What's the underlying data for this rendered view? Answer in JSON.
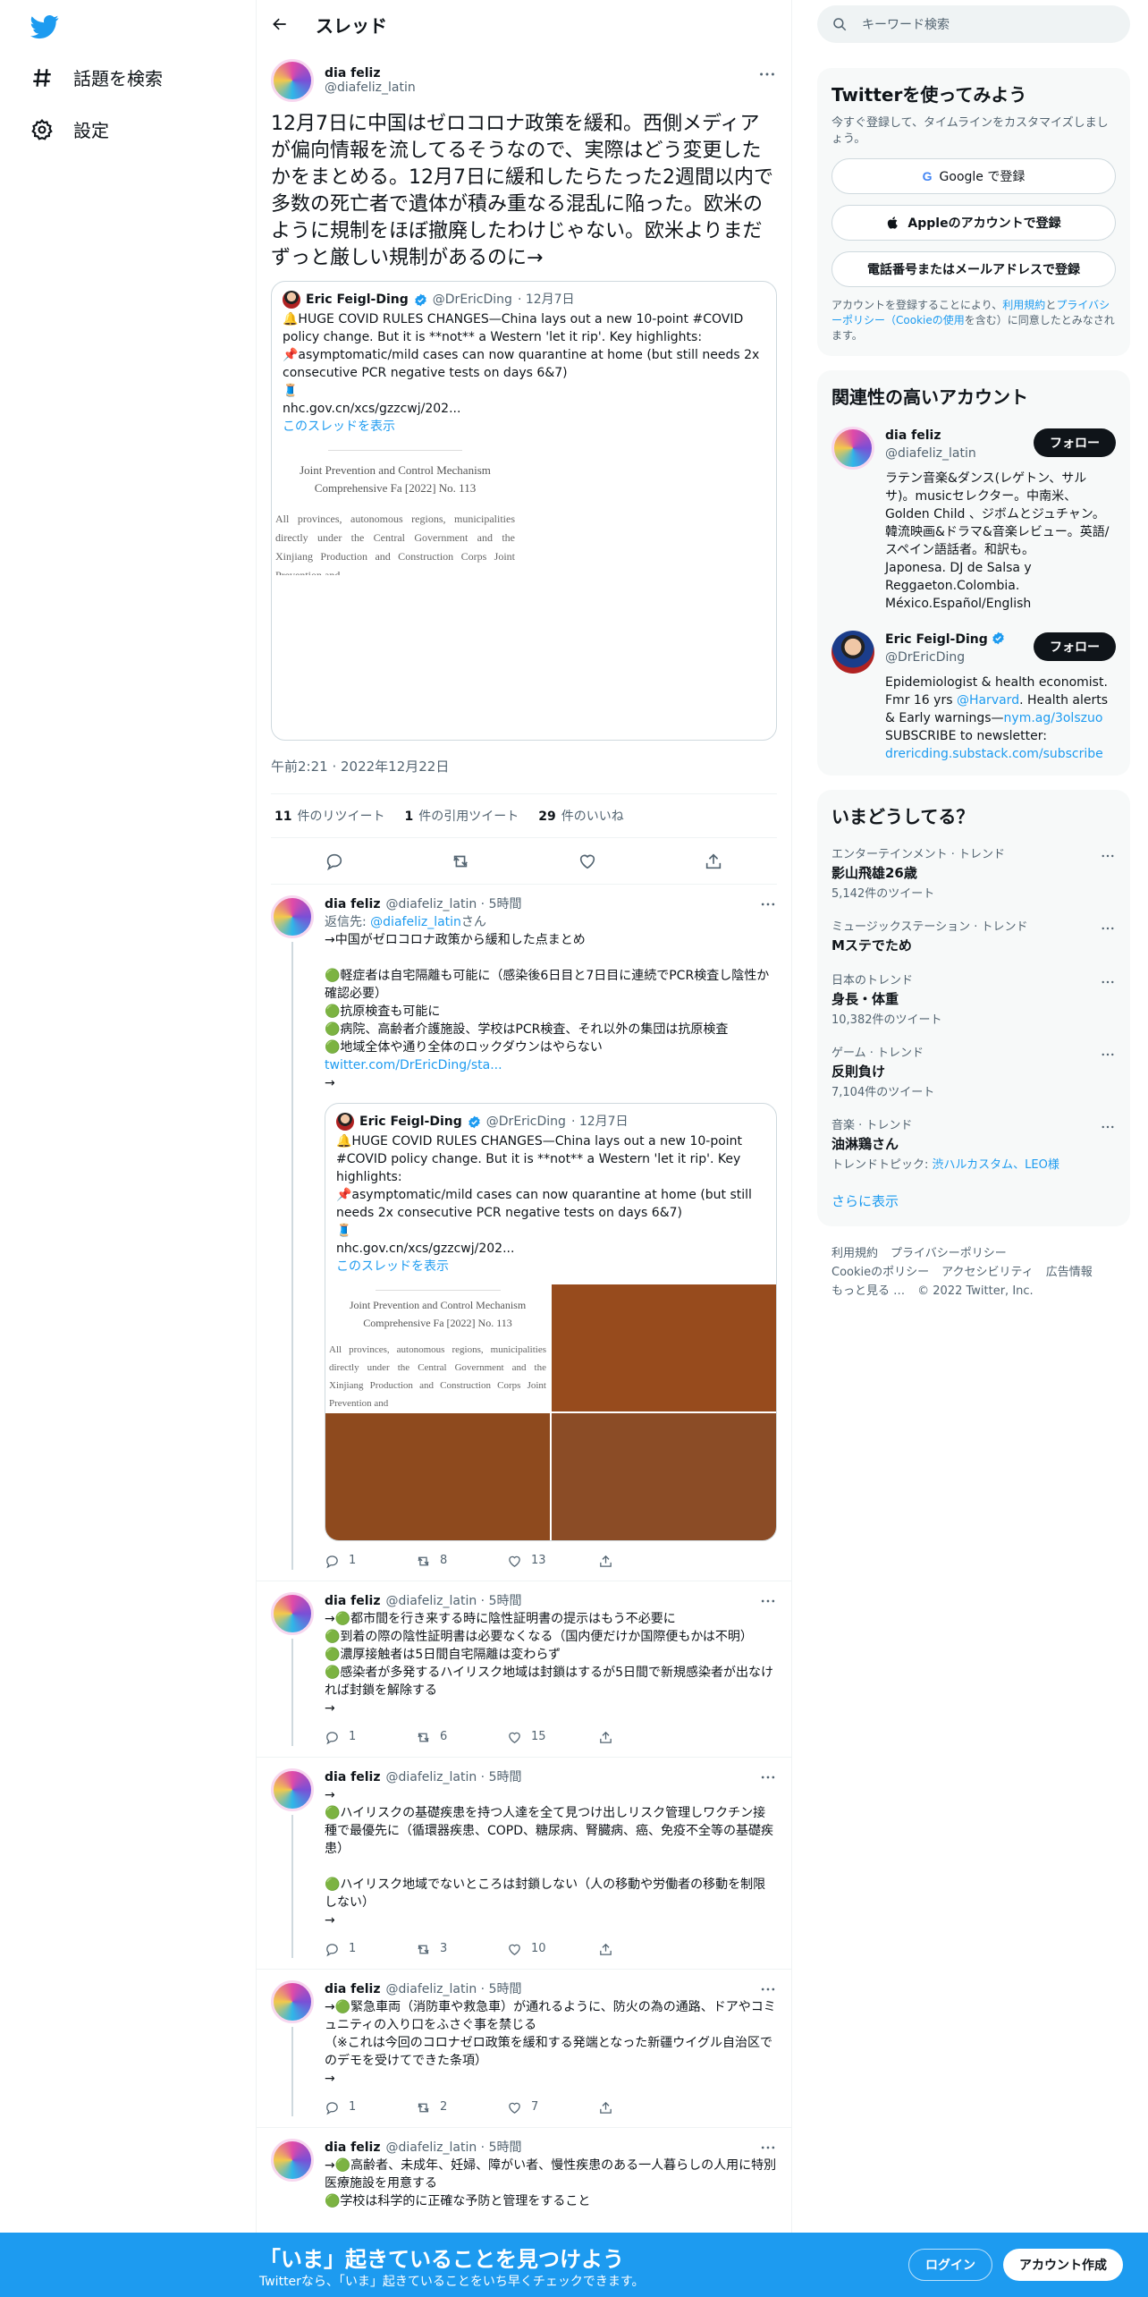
{
  "nav": {
    "explore": "話題を検索",
    "settings": "設定"
  },
  "header": {
    "title": "スレッド"
  },
  "focus": {
    "name": "dia feliz",
    "handle": "@diafeliz_latin",
    "text": "12月7日に中国はゼロコロナ政策を緩和。西側メディアが偏向情報を流してるそうなので、実際はどう変更したかをまとめる。12月7日に緩和したらたった2週間以内で多数の死亡者で遺体が積み重なる混乱に陥った。欧米のように規制をほぼ撤廃したわけじゃない。欧米よりまだずっと厳しい規制があるのに→",
    "quote": {
      "name": "Eric Feigl-Ding",
      "handle": "@DrEricDing",
      "date": "· 12月7日",
      "text": "🔔HUGE COVID RULES CHANGES—China lays out a new 10-point #COVID policy change. But it is **not** a Western 'let it rip'. Key highlights:\n📌asymptomatic/mild cases can now quarantine at home (but still needs 2x consecutive PCR negative tests on days 6&7)\n🧵\nnhc.gov.cn/xcs/gzzcwj/202...",
      "thread_link": "このスレッドを表示",
      "doc_title": "Joint Prevention and Control Mechanism\nComprehensive Fa [2022] No. 113",
      "doc_body": "All provinces, autonomous regions, municipalities directly under the Central Government and the Xinjiang Production and Construction Corps Joint Prevention and"
    },
    "time": "午前2:21 · 2022年12月22日",
    "retweets_num": "11",
    "retweets_label": "件のリツイート",
    "quotes_num": "1",
    "quotes_label": "件の引用ツイート",
    "likes_num": "29",
    "likes_label": "件のいいね"
  },
  "replies": [
    {
      "name": "dia feliz",
      "meta": "@diafeliz_latin · 5時間",
      "reply_to_label": "返信先: ",
      "reply_to_handle": "@diafeliz_latin",
      "reply_to_suffix": "さん",
      "text": "→中国がゼロコロナ政策から緩和した点まとめ\n\n🟢軽症者は自宅隔離も可能に（感染後6日目と7日目に連続でPCR検査し陰性か確認必要）\n🟢抗原検査も可能に\n🟢病院、高齢者介護施設、学校はPCR検査、それ以外の集団は抗原検査\n🟢地域全体や通り全体のロックダウンはやらない",
      "link": "twitter.com/DrEricDing/sta...",
      "tail": "→",
      "quote": {
        "name": "Eric Feigl-Ding",
        "handle": "@DrEricDing",
        "date": "· 12月7日",
        "text": "🔔HUGE COVID RULES CHANGES—China lays out a new 10-point #COVID policy change. But it is **not** a Western 'let it rip'. Key highlights:\n📌asymptomatic/mild cases can now quarantine at home (but still needs 2x consecutive PCR negative tests on days 6&7)\n🧵\nnhc.gov.cn/xcs/gzzcwj/202...",
        "thread_link": "このスレッドを表示"
      },
      "replies": "1",
      "retweets": "8",
      "likes": "13"
    },
    {
      "name": "dia feliz",
      "meta": "@diafeliz_latin · 5時間",
      "text": "→🟢都市間を行き来する時に陰性証明書の提示はもう不必要に\n🟢到着の際の陰性証明書は必要なくなる（国内便だけか国際便もかは不明）\n🟢濃厚接触者は5日間自宅隔離は変わらず\n🟢感染者が多発するハイリスク地域は封鎖はするが5日間で新規感染者が出なければ封鎖を解除する\n→",
      "replies": "1",
      "retweets": "6",
      "likes": "15"
    },
    {
      "name": "dia feliz",
      "meta": "@diafeliz_latin · 5時間",
      "text": "→\n🟢ハイリスクの基礎疾患を持つ人達を全て見つけ出しリスク管理しワクチン接種で最優先に（循環器疾患、COPD、糖尿病、腎臓病、癌、免疫不全等の基礎疾患）\n\n🟢ハイリスク地域でないところは封鎖しない（人の移動や労働者の移動を制限しない）\n→",
      "replies": "1",
      "retweets": "3",
      "likes": "10"
    },
    {
      "name": "dia feliz",
      "meta": "@diafeliz_latin · 5時間",
      "text": "→🟢緊急車両（消防車や救急車）が通れるように、防火の為の通路、ドアやコミュニティの入り口をふさぐ事を禁じる\n（※これは今回のコロナゼロ政策を緩和する発端となった新疆ウイグル自治区でのデモを受けてできた条項）\n→",
      "replies": "1",
      "retweets": "2",
      "likes": "7"
    },
    {
      "name": "dia feliz",
      "meta": "@diafeliz_latin · 5時間",
      "text": "→🟢高齢者、未成年、妊婦、障がい者、慢性疾患のある一人暮らしの人用に特別医療施設を用意する\n🟢学校は科学的に正確な予防と管理をすること"
    }
  ],
  "search": {
    "placeholder": "キーワード検索"
  },
  "signup": {
    "title": "Twitterを使ってみよう",
    "sub": "今すぐ登録して、タイムラインをカスタマイズしましょう。",
    "google": "Google で登録",
    "apple": "Appleのアカウントで登録",
    "phone": "電話番号またはメールアドレスで登録",
    "terms_prefix": "アカウントを登録することにより、",
    "terms_link1": "利用規約",
    "terms_mid": "と",
    "terms_link2": "プライバシーポリシー（Cookieの使用",
    "terms_suffix": "を含む）に同意したとみなされます。"
  },
  "relevant": {
    "title": "関連性の高いアカウント",
    "follow": "フォロー",
    "accounts": [
      {
        "name": "dia feliz",
        "handle": "@diafeliz_latin",
        "bio": "ラテン音楽&ダンス(レゲトン、サルサ)。musicセレクター。中南米、Golden Child 、ジボムとジュチャン。韓流映画&ドラマ&音楽レビュー。英語/スペイン語話者。和訳も。\nJaponesa. DJ de Salsa y Reggaeton.Colombia. México.Español/English"
      },
      {
        "name": "Eric Feigl-Ding",
        "handle": "@DrEricDing",
        "bio_pre": "Epidemiologist & health economist. Fmr 16 yrs ",
        "bio_link1": "@Harvard",
        "bio_mid": ". Health alerts & Early warnings—",
        "bio_link2": "nym.ag/3olszuo",
        "bio_post": " SUBSCRIBE to newsletter: ",
        "bio_link3": "drericding.substack.com/subscribe"
      }
    ]
  },
  "trends": {
    "title": "いまどうしてる？",
    "items": [
      {
        "cat": "エンターテインメント · トレンド",
        "name": "影山飛雄26歳",
        "count": "5,142件のツイート"
      },
      {
        "cat": "ミュージックステーション · トレンド",
        "name": "Mステでため",
        "count": ""
      },
      {
        "cat": "日本のトレンド",
        "name": "身長・体重",
        "count": "10,382件のツイート"
      },
      {
        "cat": "ゲーム · トレンド",
        "name": "反則負け",
        "count": "7,104件のツイート"
      },
      {
        "cat": "音楽 · トレンド",
        "name": "油淋鶏さん",
        "count_prefix": "トレンドトピック: ",
        "count_link": "渋ハルカスタム、LEO様"
      }
    ],
    "show_more": "さらに表示"
  },
  "footer": {
    "links": [
      "利用規約",
      "プライバシーポリシー",
      "Cookieのポリシー",
      "アクセシビリティ",
      "広告情報",
      "もっと見る …",
      "© 2022 Twitter, Inc."
    ]
  },
  "bottom": {
    "title": "「いま」起きていることを見つけよう",
    "sub": "Twitterなら、「いま」起きていることをいち早くチェックできます。",
    "login": "ログイン",
    "signup": "アカウント作成"
  },
  "colors": {
    "accent": "#1d9bf0",
    "text": "#0f1419",
    "muted": "#536471"
  }
}
